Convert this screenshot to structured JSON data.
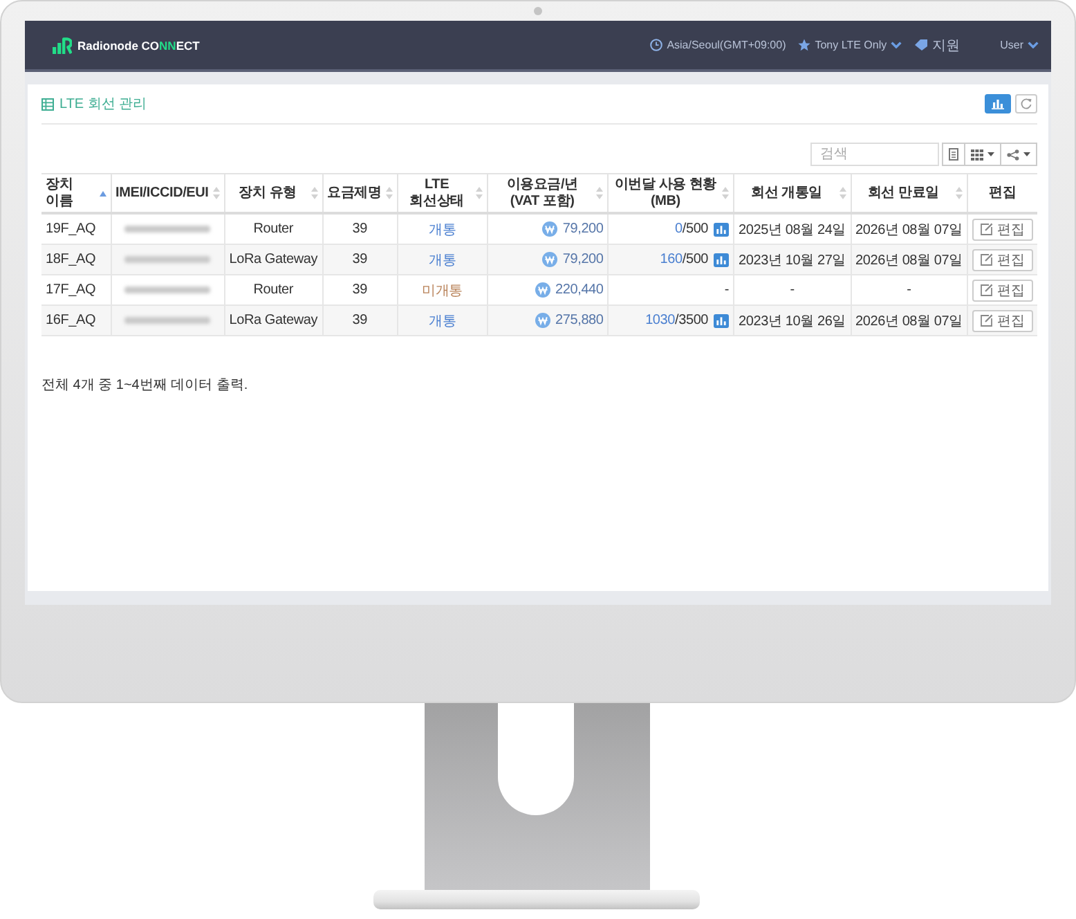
{
  "header": {
    "logo": [
      {
        "text": "Radionode CO",
        "accent": false
      },
      {
        "text": "NN",
        "accent": true
      },
      {
        "text": "ECT",
        "accent": false
      }
    ],
    "nav": [
      {
        "kind": "timezone",
        "label": "Asia/Seoul(GMT+09:00)",
        "dropdown": false
      },
      {
        "kind": "project",
        "label": "Tony LTE Only",
        "dropdown": true
      },
      {
        "kind": "support",
        "label": "지원",
        "dropdown": false
      },
      {
        "kind": "user",
        "label": "User",
        "dropdown": true
      }
    ]
  },
  "panel": {
    "title": "LTE 회선 관리",
    "title_buttons": [
      {
        "kind": "chart",
        "active": true
      },
      {
        "kind": "refresh",
        "active": false
      }
    ],
    "search": {
      "placeholder": "검색"
    },
    "toolbar_buttons": [
      {
        "kind": "print",
        "dropdown": false
      },
      {
        "kind": "columns",
        "dropdown": true
      },
      {
        "kind": "share",
        "dropdown": true
      }
    ]
  },
  "table": {
    "columns": [
      {
        "label": "장치 이름",
        "sortable": true,
        "sorted": true
      },
      {
        "label": "IMEI/ICCID/EUI",
        "sortable": true,
        "sorted": false
      },
      {
        "label": "장치 유형",
        "sortable": true,
        "sorted": false
      },
      {
        "label": "요금제명",
        "sortable": true,
        "sorted": false
      },
      {
        "label": "LTE 회선상태",
        "sortable": true,
        "sorted": false
      },
      {
        "label": "이용요금/년(VAT 포함)",
        "sortable": true,
        "sorted": false
      },
      {
        "label": "이번달 사용 현황(MB)",
        "sortable": true,
        "sorted": false
      },
      {
        "label": "회선 개통일",
        "sortable": true,
        "sorted": false
      },
      {
        "label": "회선 만료일",
        "sortable": true,
        "sorted": false
      },
      {
        "label": "편집",
        "sortable": false,
        "sorted": false
      }
    ],
    "rows": [
      {
        "device_name": "19F_AQ",
        "id_redacted": true,
        "device_type": "Router",
        "plan": "39",
        "line_status": {
          "label": "개통",
          "active": true
        },
        "fee": "79,200",
        "usage": {
          "kind": "value",
          "used": "0",
          "limit": "/500",
          "chart": true
        },
        "activated_on": "2025년 08월 24일",
        "expires_on": "2026년 08월 07일",
        "edit": "편집"
      },
      {
        "device_name": "18F_AQ",
        "id_redacted": true,
        "device_type": "LoRa Gateway",
        "plan": "39",
        "line_status": {
          "label": "개통",
          "active": true
        },
        "fee": "79,200",
        "usage": {
          "kind": "value",
          "used": "160",
          "limit": "/500",
          "chart": true
        },
        "activated_on": "2023년 10월 27일",
        "expires_on": "2026년 08월 07일",
        "edit": "편집"
      },
      {
        "device_name": "17F_AQ",
        "id_redacted": true,
        "device_type": "Router",
        "plan": "39",
        "line_status": {
          "label": "미개통",
          "active": false
        },
        "fee": "220,440",
        "usage": {
          "kind": "empty",
          "text": "-"
        },
        "activated_on": "-",
        "expires_on": "-",
        "edit": "편집"
      },
      {
        "device_name": "16F_AQ",
        "id_redacted": true,
        "device_type": "LoRa Gateway",
        "plan": "39",
        "line_status": {
          "label": "개통",
          "active": true
        },
        "fee": "275,880",
        "usage": {
          "kind": "value",
          "used": "1030",
          "limit": "/3500",
          "chart": true
        },
        "activated_on": "2023년 10월 26일",
        "expires_on": "2026년 08월 07일",
        "edit": "편집"
      }
    ],
    "summary": "전체 4개 중 1~4번째 데이터 출력."
  }
}
